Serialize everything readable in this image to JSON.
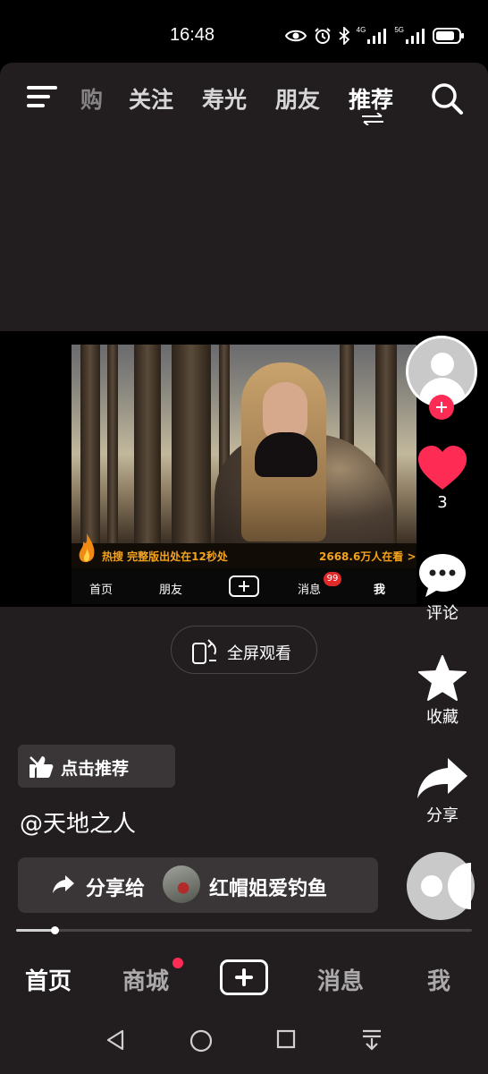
{
  "status_bar": {
    "time": "16:48",
    "icons": [
      "eye-icon",
      "alarm-icon",
      "bluetooth-icon",
      "signal-4g-icon",
      "signal-5g-icon",
      "battery-icon"
    ],
    "net_4g": "4G",
    "net_5g": "5G"
  },
  "top_nav": {
    "tabs": [
      {
        "label": "购"
      },
      {
        "label": "关注"
      },
      {
        "label": "寿光"
      },
      {
        "label": "朋友"
      },
      {
        "label": "推荐"
      }
    ],
    "active_tab": "推荐"
  },
  "video": {
    "ticker_left": "热搜 完整版出处在12秒处",
    "ticker_right": "2668.6万人在看 >",
    "nav_items": [
      {
        "label": "首页"
      },
      {
        "label": "朋友"
      },
      {
        "label": "消息"
      },
      {
        "label": "我"
      }
    ],
    "badge": "99"
  },
  "fullscreen_button": {
    "label": "全屏观看"
  },
  "actions": {
    "likes": "3",
    "comment_label": "评论",
    "favorite_label": "收藏",
    "share_label": "分享"
  },
  "recommend": {
    "label": "点击推荐"
  },
  "author": "@天地之人",
  "share_bar": {
    "label": "分享给",
    "friend_name": "红帽姐爱钓鱼"
  },
  "playback": {
    "progress": 0.085
  },
  "bottom_nav": {
    "items": [
      {
        "label": "首页"
      },
      {
        "label": "商城"
      },
      {
        "label": "消息"
      },
      {
        "label": "我"
      }
    ],
    "active": "首页"
  },
  "colors": {
    "background": "#221e1f",
    "accent": "#fe2c55",
    "ticker": "#f4a31c"
  }
}
